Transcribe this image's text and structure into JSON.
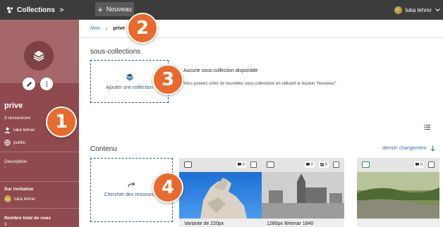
{
  "topbar": {
    "brand_label": "Collections",
    "brand_chevron": ">",
    "new_button_label": "Nouveau",
    "user_name": "luka lehrer",
    "user_initials": "LL"
  },
  "sidebar": {
    "title": "prive",
    "resources": "3 ressources",
    "owner": "luka lehrer",
    "visibility": "public",
    "description_label": "Description",
    "description_value": "-",
    "invitation_label": "Sur invitation",
    "invitation_user": "luka lehrer",
    "invitation_initials": "LL",
    "views_label": "Nombre total de vues",
    "views_value": "3"
  },
  "breadcrumb": {
    "root": "Mon",
    "current": "prive"
  },
  "subcollections": {
    "title": "sous-collections",
    "add_label": "Ajouter une collection",
    "empty_title": "Aucune sous-collection disponible",
    "empty_desc": "Vous pouvez créer de nouvelles sous-collections en utilisant le bouton \"Nouveau\"."
  },
  "content": {
    "title": "Contenu",
    "sort_label": "dernier changement",
    "search_label": "Chercher des ressources",
    "cards": [
      {
        "comments": "0",
        "layers": "",
        "caption": "Variante de 220px"
      },
      {
        "comments": "0",
        "layers": "0",
        "caption": "1280px Weimar 1840"
      },
      {
        "comments": "0",
        "layers": "",
        "caption": ""
      }
    ]
  },
  "markers": [
    "1",
    "2",
    "3",
    "4"
  ],
  "colors": {
    "sidebar_bg": "#8e4a4e",
    "topbar_bg": "#3c3c3c",
    "accent": "#2d5a86",
    "marker": "#e86a2c"
  }
}
